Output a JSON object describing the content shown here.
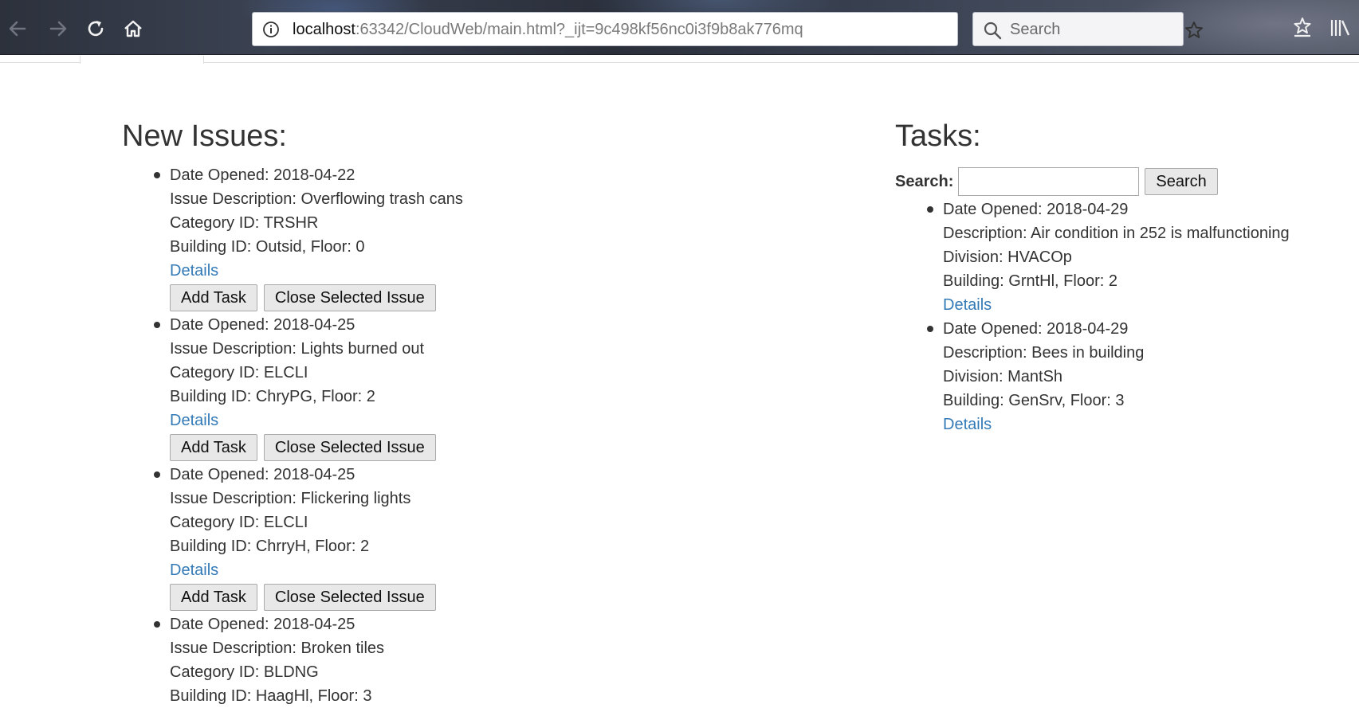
{
  "browser": {
    "url_host": "localhost",
    "url_rest": ":63342/CloudWeb/main.html?_ijt=9c498kf56nc0i3f9b8ak776mq",
    "url_overflow": "•••",
    "search_placeholder": "Search"
  },
  "issues": {
    "heading": "New Issues:",
    "items": [
      {
        "date": "Date Opened: 2018-04-22",
        "description": "Issue Description: Overflowing trash cans",
        "category": "Category ID: TRSHR",
        "building": "Building ID: Outsid, Floor: 0",
        "details": "Details",
        "add_task": "Add Task",
        "close": "Close Selected Issue"
      },
      {
        "date": "Date Opened: 2018-04-25",
        "description": "Issue Description: Lights burned out",
        "category": "Category ID: ELCLI",
        "building": "Building ID: ChryPG, Floor: 2",
        "details": "Details",
        "add_task": "Add Task",
        "close": "Close Selected Issue"
      },
      {
        "date": "Date Opened: 2018-04-25",
        "description": "Issue Description: Flickering lights",
        "category": "Category ID: ELCLI",
        "building": "Building ID: ChrryH, Floor: 2",
        "details": "Details",
        "add_task": "Add Task",
        "close": "Close Selected Issue"
      },
      {
        "date": "Date Opened: 2018-04-25",
        "description": "Issue Description: Broken tiles",
        "category": "Category ID: BLDNG",
        "building": "Building ID: HaagHl, Floor: 3"
      }
    ]
  },
  "tasks": {
    "heading": "Tasks:",
    "search_label": "Search:",
    "search_value": "",
    "search_button": "Search",
    "items": [
      {
        "date": "Date Opened: 2018-04-29",
        "description": "Description: Air condition in 252 is malfunctioning",
        "division": "Division: HVACOp",
        "building": "Building: GrntHl, Floor: 2",
        "details": "Details"
      },
      {
        "date": "Date Opened: 2018-04-29",
        "description": "Description: Bees in building",
        "division": "Division: MantSh",
        "building": "Building: GenSrv, Floor: 3",
        "details": "Details"
      }
    ]
  }
}
